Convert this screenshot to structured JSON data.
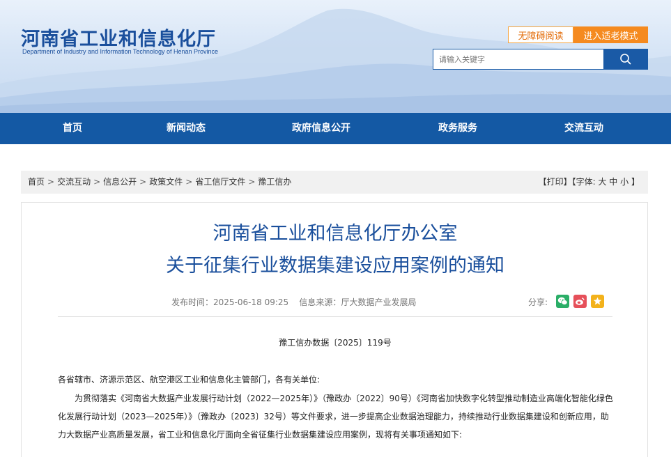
{
  "header": {
    "site_title": "河南省工业和信息化厅",
    "site_subtitle": "Department of Industry and Information Technology of Henan Province",
    "accessible_label": "无障碍阅读",
    "elder_mode_label": "进入适老模式",
    "search_placeholder": "请输入关键字",
    "search_icon": "search-icon"
  },
  "nav": {
    "items": [
      {
        "label": "首页"
      },
      {
        "label": "新闻动态"
      },
      {
        "label": "政府信息公开"
      },
      {
        "label": "政务服务"
      },
      {
        "label": "交流互动"
      }
    ]
  },
  "breadcrumb": {
    "items": [
      "首页",
      "交流互动",
      "信息公开",
      "政策文件",
      "省工信厅文件",
      "豫工信办"
    ],
    "separator": ">"
  },
  "tools": {
    "print": "【打印】",
    "font_prefix": "【字体:",
    "font_large": "大",
    "font_medium": "中",
    "font_small": "小",
    "font_suffix": "】"
  },
  "article": {
    "title_line1": "河南省工业和信息化厅办公室",
    "title_line2": "关于征集行业数据集建设应用案例的通知",
    "publish_label": "发布时间：",
    "publish_time": "2025-06-18 09:25",
    "source_label": "信息来源：",
    "source": "厅大数据产业发展局",
    "share_label": "分享:",
    "doc_number": "豫工信办数据〔2025〕119号",
    "addressee": "各省辖市、济源示范区、航空港区工业和信息化主管部门，各有关单位:",
    "body": "为贯彻落实《河南省大数据产业发展行动计划（2022—2025年）》（豫政办〔2022〕90号）《河南省加快数字化转型推动制造业高端化智能化绿色化发展行动计划（2023—2025年）》（豫政办〔2023〕32号）等文件要求，进一步提高企业数据治理能力，持续推动行业数据集建设和创新应用，助力大数据产业高质量发展，省工业和信息化厅面向全省征集行业数据集建设应用案例，现将有关事项通知如下:"
  },
  "colors": {
    "brand_blue": "#1459a4",
    "title_blue": "#1a4f9c",
    "accent_orange": "#f58a1f",
    "wechat_green": "#2aae67",
    "weibo_red": "#e6505a",
    "favorite_yellow": "#f3b21b"
  }
}
